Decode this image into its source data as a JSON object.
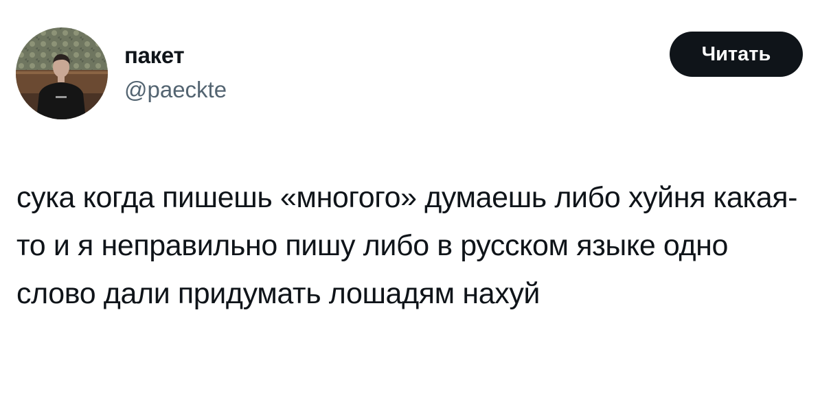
{
  "author": {
    "display_name": "пакет",
    "handle": "@paeckte",
    "avatar_icon": "user-photo-avatar"
  },
  "actions": {
    "follow_label": "Читать"
  },
  "tweet": {
    "text": "сука когда пишешь «многого» думаешь либо хуйня какая-то и я неправильно пишу либо в русском языке одно слово дали придумать лошадям нахуй"
  },
  "colors": {
    "text_primary": "#0f1419",
    "text_secondary": "#536471",
    "button_bg": "#0f1419",
    "button_text": "#ffffff",
    "background": "#ffffff"
  }
}
